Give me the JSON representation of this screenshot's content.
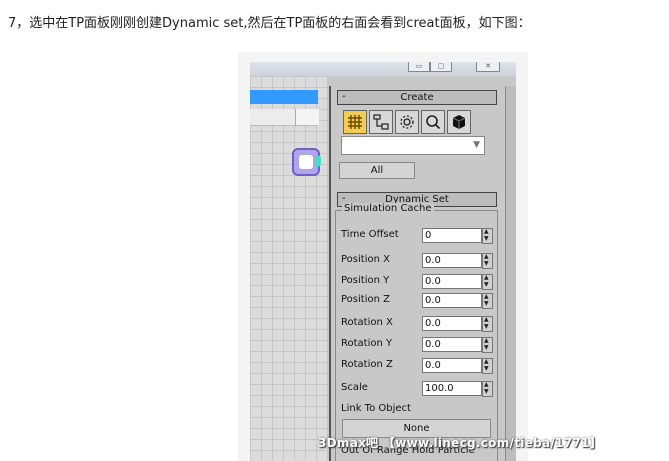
{
  "article": {
    "text": "7，选中在TP面板刚刚创建Dynamic set,然后在TP面板的右面会看到creat面板，如下图："
  },
  "create_rollout": {
    "minus": "-",
    "title": "Create",
    "tabs": [
      {
        "icon": "particle-grid-icon",
        "active": true
      },
      {
        "icon": "hierarchy-icon",
        "active": false
      },
      {
        "icon": "gear-icon",
        "active": false
      },
      {
        "icon": "magnifier-icon",
        "active": false
      },
      {
        "icon": "cube-icon",
        "active": false
      }
    ],
    "dropdown_value": "",
    "all_label": "All"
  },
  "dynamic_set": {
    "minus": "-",
    "title": "Dynamic Set",
    "group_title": "Simulation Cache",
    "fields": [
      {
        "label": "Time Offset",
        "value": "0"
      },
      {
        "label": "Position X",
        "value": "0.0"
      },
      {
        "label": "Position Y",
        "value": "0.0"
      },
      {
        "label": "Position Z",
        "value": "0.0"
      },
      {
        "label": "Rotation X",
        "value": "0.0"
      },
      {
        "label": "Rotation Y",
        "value": "0.0"
      },
      {
        "label": "Rotation Z",
        "value": "0.0"
      },
      {
        "label": "Scale",
        "value": "100.0"
      }
    ],
    "link_label": "Link To Object",
    "link_button": "None",
    "out_of_range": "Out Of Range Hold Particle"
  },
  "watermark": {
    "text": "3Dmax吧 【www.linecg.com/tieba/1771】"
  }
}
